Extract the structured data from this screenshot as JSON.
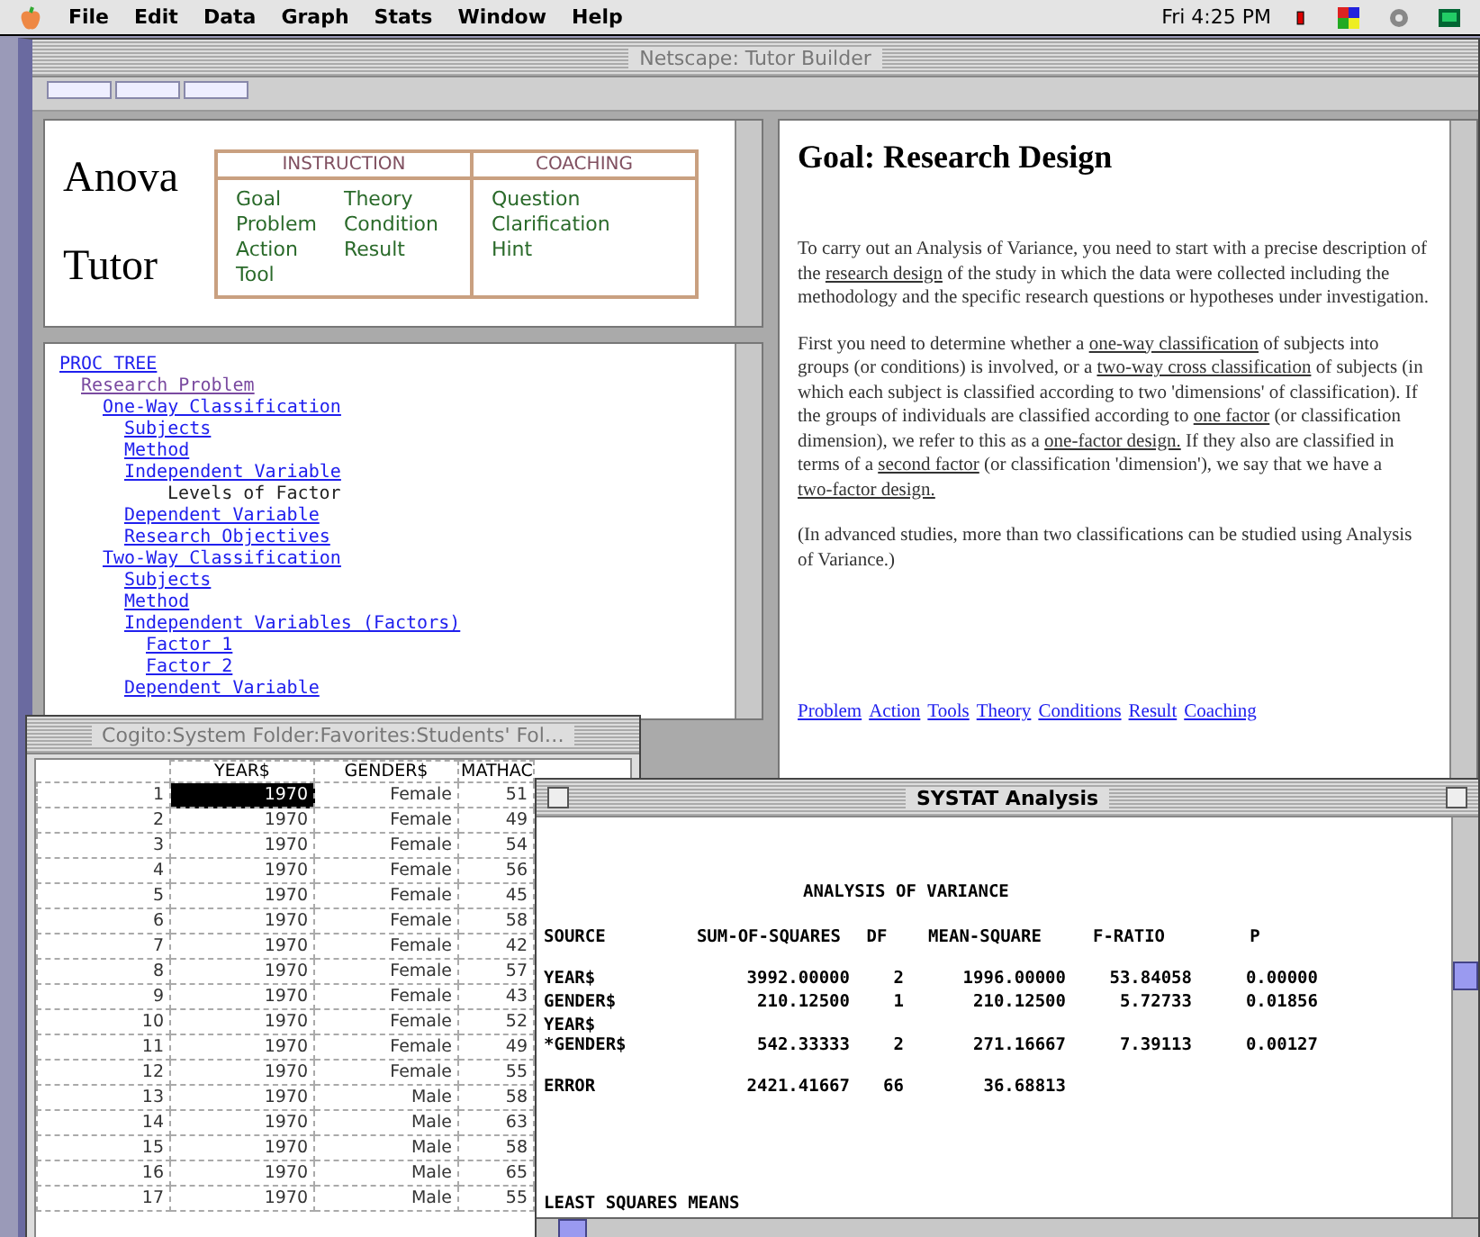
{
  "menu_bar": {
    "items": [
      "File",
      "Edit",
      "Data",
      "Graph",
      "Stats",
      "Window",
      "Help"
    ],
    "clock": "Fri 4:25 PM"
  },
  "browser": {
    "title": "Netscape: Tutor Builder",
    "logo_lines": [
      "Anova",
      "Tutor"
    ],
    "instruction": {
      "heading": "INSTRUCTION",
      "links": [
        "Goal",
        "Theory",
        "Problem",
        "Condition",
        "Action",
        "Result",
        "Tool"
      ]
    },
    "coaching": {
      "heading": "COACHING",
      "links": [
        "Question",
        "Clarification",
        "Hint"
      ]
    },
    "tree": [
      {
        "label": "PROC TREE",
        "kind": "link",
        "visited": false,
        "children": [
          {
            "label": "Research Problem",
            "kind": "link",
            "visited": true,
            "children": [
              {
                "label": "One-Way Classification",
                "kind": "link",
                "visited": false,
                "children": [
                  {
                    "label": "Subjects",
                    "kind": "link",
                    "visited": false
                  },
                  {
                    "label": "Method",
                    "kind": "link",
                    "visited": false
                  },
                  {
                    "label": "Independent Variable",
                    "kind": "link",
                    "visited": false,
                    "children": [
                      {
                        "label": "Levels of Factor",
                        "kind": "text",
                        "visited": false
                      }
                    ]
                  },
                  {
                    "label": "Dependent Variable",
                    "kind": "link",
                    "visited": false
                  },
                  {
                    "label": "Research Objectives",
                    "kind": "link",
                    "visited": false
                  }
                ]
              },
              {
                "label": "Two-Way Classification",
                "kind": "link",
                "visited": false,
                "children": [
                  {
                    "label": "Subjects",
                    "kind": "link",
                    "visited": false
                  },
                  {
                    "label": "Method",
                    "kind": "link",
                    "visited": false
                  },
                  {
                    "label": "Independent Variables (Factors)",
                    "kind": "link",
                    "visited": false,
                    "children": [
                      {
                        "label": "Factor 1",
                        "kind": "link",
                        "visited": false
                      },
                      {
                        "label": "Factor 2",
                        "kind": "link",
                        "visited": false
                      }
                    ]
                  },
                  {
                    "label": "Dependent Variable",
                    "kind": "link",
                    "visited": false
                  }
                ]
              }
            ]
          }
        ]
      }
    ],
    "content": {
      "heading": "Goal: Research Design",
      "paragraphs": [
        [
          {
            "text": "To carry out an Analysis of Variance, you need to start with a precise description of the ",
            "kind": "text"
          },
          {
            "text": "research design",
            "kind": "link"
          },
          {
            "text": " of the study in which the data were collected including the methodology and the specific research questions or hypotheses under investigation.",
            "kind": "text"
          }
        ],
        [
          {
            "text": "First you need to determine whether a ",
            "kind": "text"
          },
          {
            "text": "one-way classification",
            "kind": "link"
          },
          {
            "text": " of subjects into groups (or conditions) is involved, or a ",
            "kind": "text"
          },
          {
            "text": "two-way cross classification",
            "kind": "link"
          },
          {
            "text": " of subjects (in which each subject is classified according to two 'dimensions' of classification). If the groups of individuals are classified according to ",
            "kind": "text"
          },
          {
            "text": "one factor",
            "kind": "link"
          },
          {
            "text": " (or classification dimension), we refer to this as a ",
            "kind": "text"
          },
          {
            "text": "one-factor design.",
            "kind": "link"
          },
          {
            "text": " If they also are classified in terms of a ",
            "kind": "text"
          },
          {
            "text": "second factor",
            "kind": "link"
          },
          {
            "text": " (or classification 'dimension'), we say that we have a ",
            "kind": "text"
          },
          {
            "text": "two-factor design.",
            "kind": "link"
          }
        ],
        [
          {
            "text": "(In advanced studies, more than two classifications can be studied using Analysis of Variance.)",
            "kind": "text"
          }
        ]
      ],
      "footer_links": [
        "Problem",
        "Action",
        "Tools",
        "Theory",
        "Conditions",
        "Result",
        "Coaching"
      ]
    }
  },
  "data_window": {
    "title": "Cogito:System Folder:Favorites:Students' Fol…",
    "columns": [
      "YEAR$",
      "GENDER$",
      "MATHAC"
    ],
    "rows": [
      {
        "number": "1",
        "year": "1970",
        "gender": "Female",
        "mathach": "51",
        "selected": true
      },
      {
        "number": "2",
        "year": "1970",
        "gender": "Female",
        "mathach": "49",
        "selected": false
      },
      {
        "number": "3",
        "year": "1970",
        "gender": "Female",
        "mathach": "54",
        "selected": false
      },
      {
        "number": "4",
        "year": "1970",
        "gender": "Female",
        "mathach": "56",
        "selected": false
      },
      {
        "number": "5",
        "year": "1970",
        "gender": "Female",
        "mathach": "45",
        "selected": false
      },
      {
        "number": "6",
        "year": "1970",
        "gender": "Female",
        "mathach": "58",
        "selected": false
      },
      {
        "number": "7",
        "year": "1970",
        "gender": "Female",
        "mathach": "42",
        "selected": false
      },
      {
        "number": "8",
        "year": "1970",
        "gender": "Female",
        "mathach": "57",
        "selected": false
      },
      {
        "number": "9",
        "year": "1970",
        "gender": "Female",
        "mathach": "43",
        "selected": false
      },
      {
        "number": "10",
        "year": "1970",
        "gender": "Female",
        "mathach": "52",
        "selected": false
      },
      {
        "number": "11",
        "year": "1970",
        "gender": "Female",
        "mathach": "49",
        "selected": false
      },
      {
        "number": "12",
        "year": "1970",
        "gender": "Female",
        "mathach": "55",
        "selected": false
      },
      {
        "number": "13",
        "year": "1970",
        "gender": "Male",
        "mathach": "58",
        "selected": false
      },
      {
        "number": "14",
        "year": "1970",
        "gender": "Male",
        "mathach": "63",
        "selected": false
      },
      {
        "number": "15",
        "year": "1970",
        "gender": "Male",
        "mathach": "58",
        "selected": false
      },
      {
        "number": "16",
        "year": "1970",
        "gender": "Male",
        "mathach": "65",
        "selected": false
      },
      {
        "number": "17",
        "year": "1970",
        "gender": "Male",
        "mathach": "55",
        "selected": false
      }
    ]
  },
  "systat_window": {
    "title": "SYSTAT Analysis",
    "heading": "ANALYSIS OF VARIANCE",
    "columns": [
      "SOURCE",
      "SUM-OF-SQUARES",
      "DF",
      "MEAN-SQUARE",
      "F-RATIO",
      "P"
    ],
    "rows": [
      {
        "cells": [
          "YEAR$",
          "3992.00000",
          "2",
          "1996.00000",
          "53.84058",
          "0.00000"
        ]
      },
      {
        "cells": [
          "GENDER$",
          "210.12500",
          "1",
          "210.12500",
          "5.72733",
          "0.01856"
        ]
      },
      {
        "cells": [
          "YEAR$ *GENDER$",
          "542.33333",
          "2",
          "271.16667",
          "7.39113",
          "0.00127"
        ]
      },
      {
        "cells": [
          "ERROR",
          "2421.41667",
          "66",
          "36.68813"
        ]
      }
    ],
    "footer": "LEAST SQUARES MEANS"
  }
}
